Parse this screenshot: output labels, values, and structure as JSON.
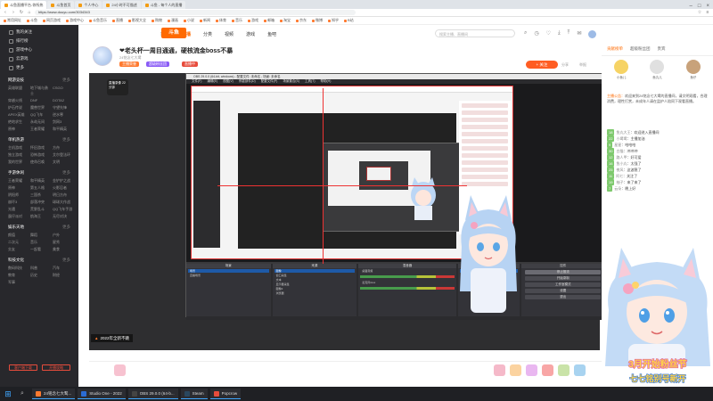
{
  "browser": {
    "tabs": [
      {
        "label": "斗鱼直播平台-你所热"
      },
      {
        "label": "斗鱼首页"
      },
      {
        "label": "个人中心"
      },
      {
        "label": "24小时不可描述"
      },
      {
        "label": "斗鱼 - 每个人的直播"
      }
    ],
    "url": "https://www.douyu.com/3034343",
    "bookmarks": [
      "常用网址",
      "斗鱼",
      "网页游戏",
      "游戏中心",
      "斗鱼音乐",
      "直播",
      "影视大全",
      "购物",
      "漫画",
      "小说",
      "新闻",
      "体育",
      "音乐",
      "游戏",
      "邮箱",
      "淘宝",
      "京东",
      "微博",
      "知乎",
      "B站"
    ]
  },
  "sidebar": {
    "top_items": [
      {
        "label": "我的关注"
      },
      {
        "label": "排行榜"
      },
      {
        "label": "游戏中心"
      },
      {
        "label": "云游戏"
      },
      {
        "label": "更多"
      }
    ],
    "sections": [
      {
        "title": "网游竞技",
        "more": "更多",
        "items": [
          "英雄联盟",
          "地下城与勇士",
          "CSGO",
          "穿越火线",
          "DNF",
          "DOTA2",
          "炉石传说",
          "魔兽世界",
          "守望先锋",
          "APEX英雄",
          "QQ飞车",
          "逆水寒",
          "绝地求生",
          "永劫无间",
          "剑网3",
          "原神",
          "王者荣耀",
          "和平精英"
        ]
      },
      {
        "title": "单机热游",
        "more": "更多",
        "items": [
          "主机游戏",
          "怀旧游戏",
          "方舟",
          "独立游戏",
          "恐怖游戏",
          "艾尔登法环",
          "我的世界",
          "使命召唤",
          "文明"
        ]
      },
      {
        "title": "手游休闲",
        "more": "更多",
        "items": [
          "王者荣耀",
          "和平精英",
          "金铲铲之战",
          "原神",
          "第五人格",
          "火影忍者",
          "阴阳师",
          "三国杀",
          "明日方舟",
          "崩坏3",
          "部落冲突",
          "球球大作战",
          "光遇",
          "荒野乱斗",
          "QQ飞车手游",
          "蛋仔派对",
          "航海王",
          "无尽对决"
        ]
      },
      {
        "title": "娱乐天地",
        "more": "更多",
        "items": [
          "颜值",
          "舞蹈",
          "户外",
          "二次元",
          "音乐",
          "星秀",
          "交友",
          "一起看",
          "美食"
        ]
      },
      {
        "title": "科技文化",
        "more": "更多",
        "items": [
          "数码科技",
          "科普",
          "汽车",
          "教育",
          "历史",
          "财经",
          "军事"
        ]
      }
    ],
    "buttons": [
      {
        "label": "客户端下载"
      },
      {
        "label": "开播攻略"
      }
    ]
  },
  "header": {
    "logo": "斗鱼",
    "nav": [
      "首页",
      "直播",
      "分类",
      "视频",
      "游戏",
      "鱼吧"
    ],
    "active_nav": "直播",
    "search_placeholder": "搜索主播、直播间"
  },
  "stream": {
    "title": "❤老头杯一周目通通，硬核流金boss不暴",
    "streamer": "24铭念七大鹭",
    "badges": [
      "主播荣誉",
      "超级粉丝团",
      "直播中"
    ],
    "follow_label": "+ 关注",
    "share_label": "分享",
    "report_label": "举报",
    "player_badge": "直播录像 22分钟"
  },
  "obs": {
    "title": "OBS 29.0.0 (64-bit, windows) - 配置文件: 未命名 - 场景: 未命名",
    "menu": [
      "文件(F)",
      "编辑(E)",
      "视图(V)",
      "停靠部件(D)",
      "配置文件(P)",
      "场景集合(S)",
      "工具(T)",
      "帮助(H)"
    ],
    "docks": [
      {
        "title": "场景",
        "rows": [
          "场景",
          "直播场景"
        ]
      },
      {
        "title": "来源",
        "rows": [
          "图像",
          "窗口采集",
          "文本",
          "显示器采集",
          "图像2",
          "浏览器"
        ]
      },
      {
        "title": "混音器",
        "rows": [
          "桌面音频",
          "麦克风/Aux"
        ]
      },
      {
        "title": "转场特效",
        "rows": [
          "淡入淡出",
          "时长 300 ms"
        ]
      },
      {
        "title": "控件",
        "rows": [
          "停止推流",
          "开始录制",
          "工作室模式",
          "设置",
          "退出"
        ]
      }
    ]
  },
  "bottom_tag": "2022年全新不跳",
  "chat": {
    "tabs": [
      "贡献榜单",
      "超级粉丝团",
      "贵宾"
    ],
    "active_tab": "贡献榜单",
    "rank": [
      {
        "name": "小鱼儿",
        "color": "#f6d365"
      },
      {
        "name": "鱼丸儿",
        "color": "#e0e0e0"
      },
      {
        "name": "鱼仔",
        "color": "#c8a27a"
      }
    ],
    "announce_label": "主播公告：",
    "announce": "欢迎来到24铭念七大鹭的直播间，请文明观看，合理消费，理性打赏，未成年人请在监护人陪同下观看直播。",
    "messages": [
      {
        "lv": "18",
        "user": "鱼丸大王",
        "text": "欢迎进入直播间"
      },
      {
        "lv": "22",
        "user": "小鹭鹭",
        "text": "主播加油"
      },
      {
        "lv": "9",
        "user": "星星",
        "text": "哈哈哈"
      },
      {
        "lv": "30",
        "user": "白猫",
        "text": "冲冲冲"
      },
      {
        "lv": "12",
        "user": "路人甲",
        "text": "好可爱"
      },
      {
        "lv": "16",
        "user": "鱼小丸",
        "text": "太强了"
      },
      {
        "lv": "25",
        "user": "夜风",
        "text": "这波稳了"
      },
      {
        "lv": "11",
        "user": "阿七",
        "text": "关注了"
      },
      {
        "lv": "19",
        "user": "柚子",
        "text": "来了来了"
      },
      {
        "lv": "7",
        "user": "云朵",
        "text": "晚上好"
      }
    ]
  },
  "banner": {
    "line1": "3月开始粉丝节",
    "line2": "七七铭别号新开"
  },
  "taskbar": {
    "tasks": [
      {
        "label": "24铭念七大鹭...",
        "color": "#ff7a2f"
      },
      {
        "label": "Studio One - 2022",
        "color": "#2b6cd4"
      },
      {
        "label": "OBS 29.0.0 (64-b...",
        "color": "#444"
      },
      {
        "label": "Steam",
        "color": "#2a475e"
      },
      {
        "label": "Popcrow",
        "color": "#e74c3c"
      }
    ]
  }
}
